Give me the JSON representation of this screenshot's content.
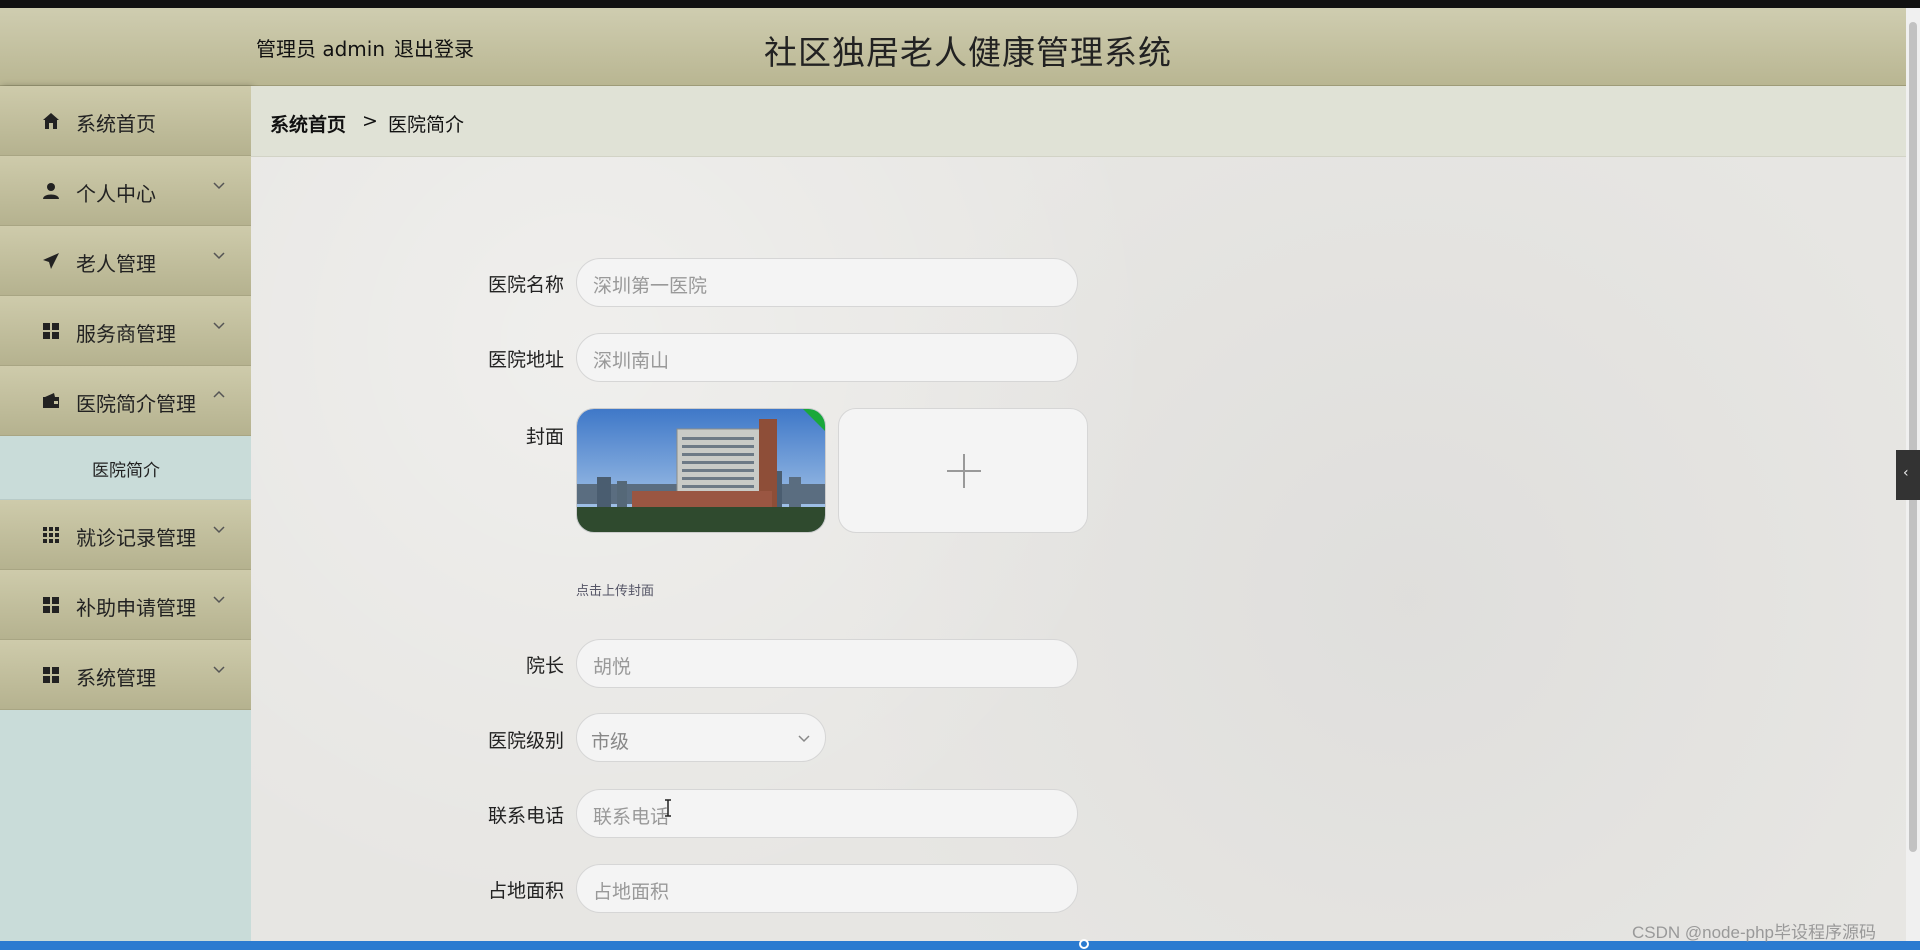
{
  "header": {
    "user_text": "管理员 admin",
    "logout": "退出登录",
    "title": "社区独居老人健康管理系统"
  },
  "sidebar": {
    "items": [
      {
        "label": "系统首页",
        "icon": "home-icon",
        "has_chevron": false
      },
      {
        "label": "个人中心",
        "icon": "user-icon",
        "has_chevron": true
      },
      {
        "label": "老人管理",
        "icon": "paper-plane-icon",
        "has_chevron": true
      },
      {
        "label": "服务商管理",
        "icon": "grid-icon",
        "has_chevron": true
      },
      {
        "label": "医院简介管理",
        "icon": "wallet-icon",
        "has_chevron": true,
        "expanded": true
      },
      {
        "label": "就诊记录管理",
        "icon": "grid-nine-icon",
        "has_chevron": true
      },
      {
        "label": "补助申请管理",
        "icon": "grid-icon",
        "has_chevron": true
      },
      {
        "label": "系统管理",
        "icon": "grid-icon",
        "has_chevron": true
      }
    ],
    "submenu": {
      "label": "医院简介"
    }
  },
  "breadcrumb": {
    "home": "系统首页",
    "separator": ">",
    "current": "医院简介"
  },
  "form": {
    "hospital_name": {
      "label": "医院名称",
      "value": "深圳第一医院"
    },
    "hospital_address": {
      "label": "医院地址",
      "value": "深圳南山"
    },
    "cover": {
      "label": "封面",
      "hint": "点击上传封面"
    },
    "director": {
      "label": "院长",
      "value": "胡悦"
    },
    "level": {
      "label": "医院级别",
      "value": "市级"
    },
    "phone": {
      "label": "联系电话",
      "placeholder": "联系电话"
    },
    "area": {
      "label": "占地面积",
      "placeholder": "占地面积"
    }
  },
  "watermark": "CSDN @node-php毕设程序源码",
  "colors": {
    "header_bg": "#c4c1a0",
    "sidebar_bg": "#c9dcd9",
    "menu_bg": "#bfbc99",
    "main_bg": "#e7e6e3",
    "accent_blue": "#2b7bd0"
  }
}
